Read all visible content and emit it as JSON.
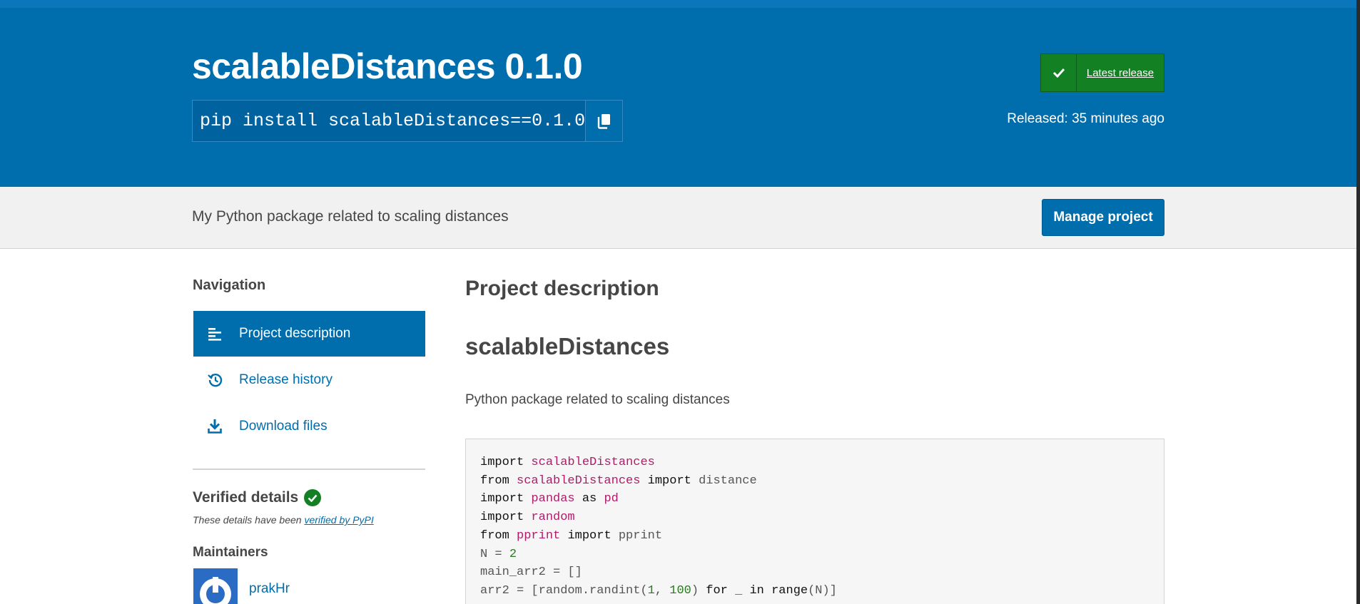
{
  "header": {
    "title": "scalableDistances 0.1.0",
    "pip_command": "pip install scalableDistances==0.1.0",
    "copy_icon": "copy-icon",
    "latest_release_label": "Latest release",
    "released_text": "Released: 35 minutes ago"
  },
  "summary": {
    "text": "My Python package related to scaling distances",
    "manage_button": "Manage project"
  },
  "sidebar": {
    "heading": "Navigation",
    "items": [
      {
        "label": "Project description",
        "icon": "align-left-icon",
        "active": true
      },
      {
        "label": "Release history",
        "icon": "history-icon",
        "active": false
      },
      {
        "label": "Download files",
        "icon": "download-icon",
        "active": false
      }
    ],
    "verified_heading": "Verified details",
    "verified_note_prefix": "These details have been ",
    "verified_note_link": "verified by PyPI",
    "maintainers_heading": "Maintainers",
    "maintainers": [
      {
        "name": "prakHr"
      }
    ]
  },
  "main": {
    "heading": "Project description",
    "readme_title": "scalableDistances",
    "readme_text": "Python package related to scaling distances"
  },
  "colors": {
    "brand_blue": "#006dad",
    "success_green": "#148024",
    "summary_bg": "#f1f1f1"
  }
}
